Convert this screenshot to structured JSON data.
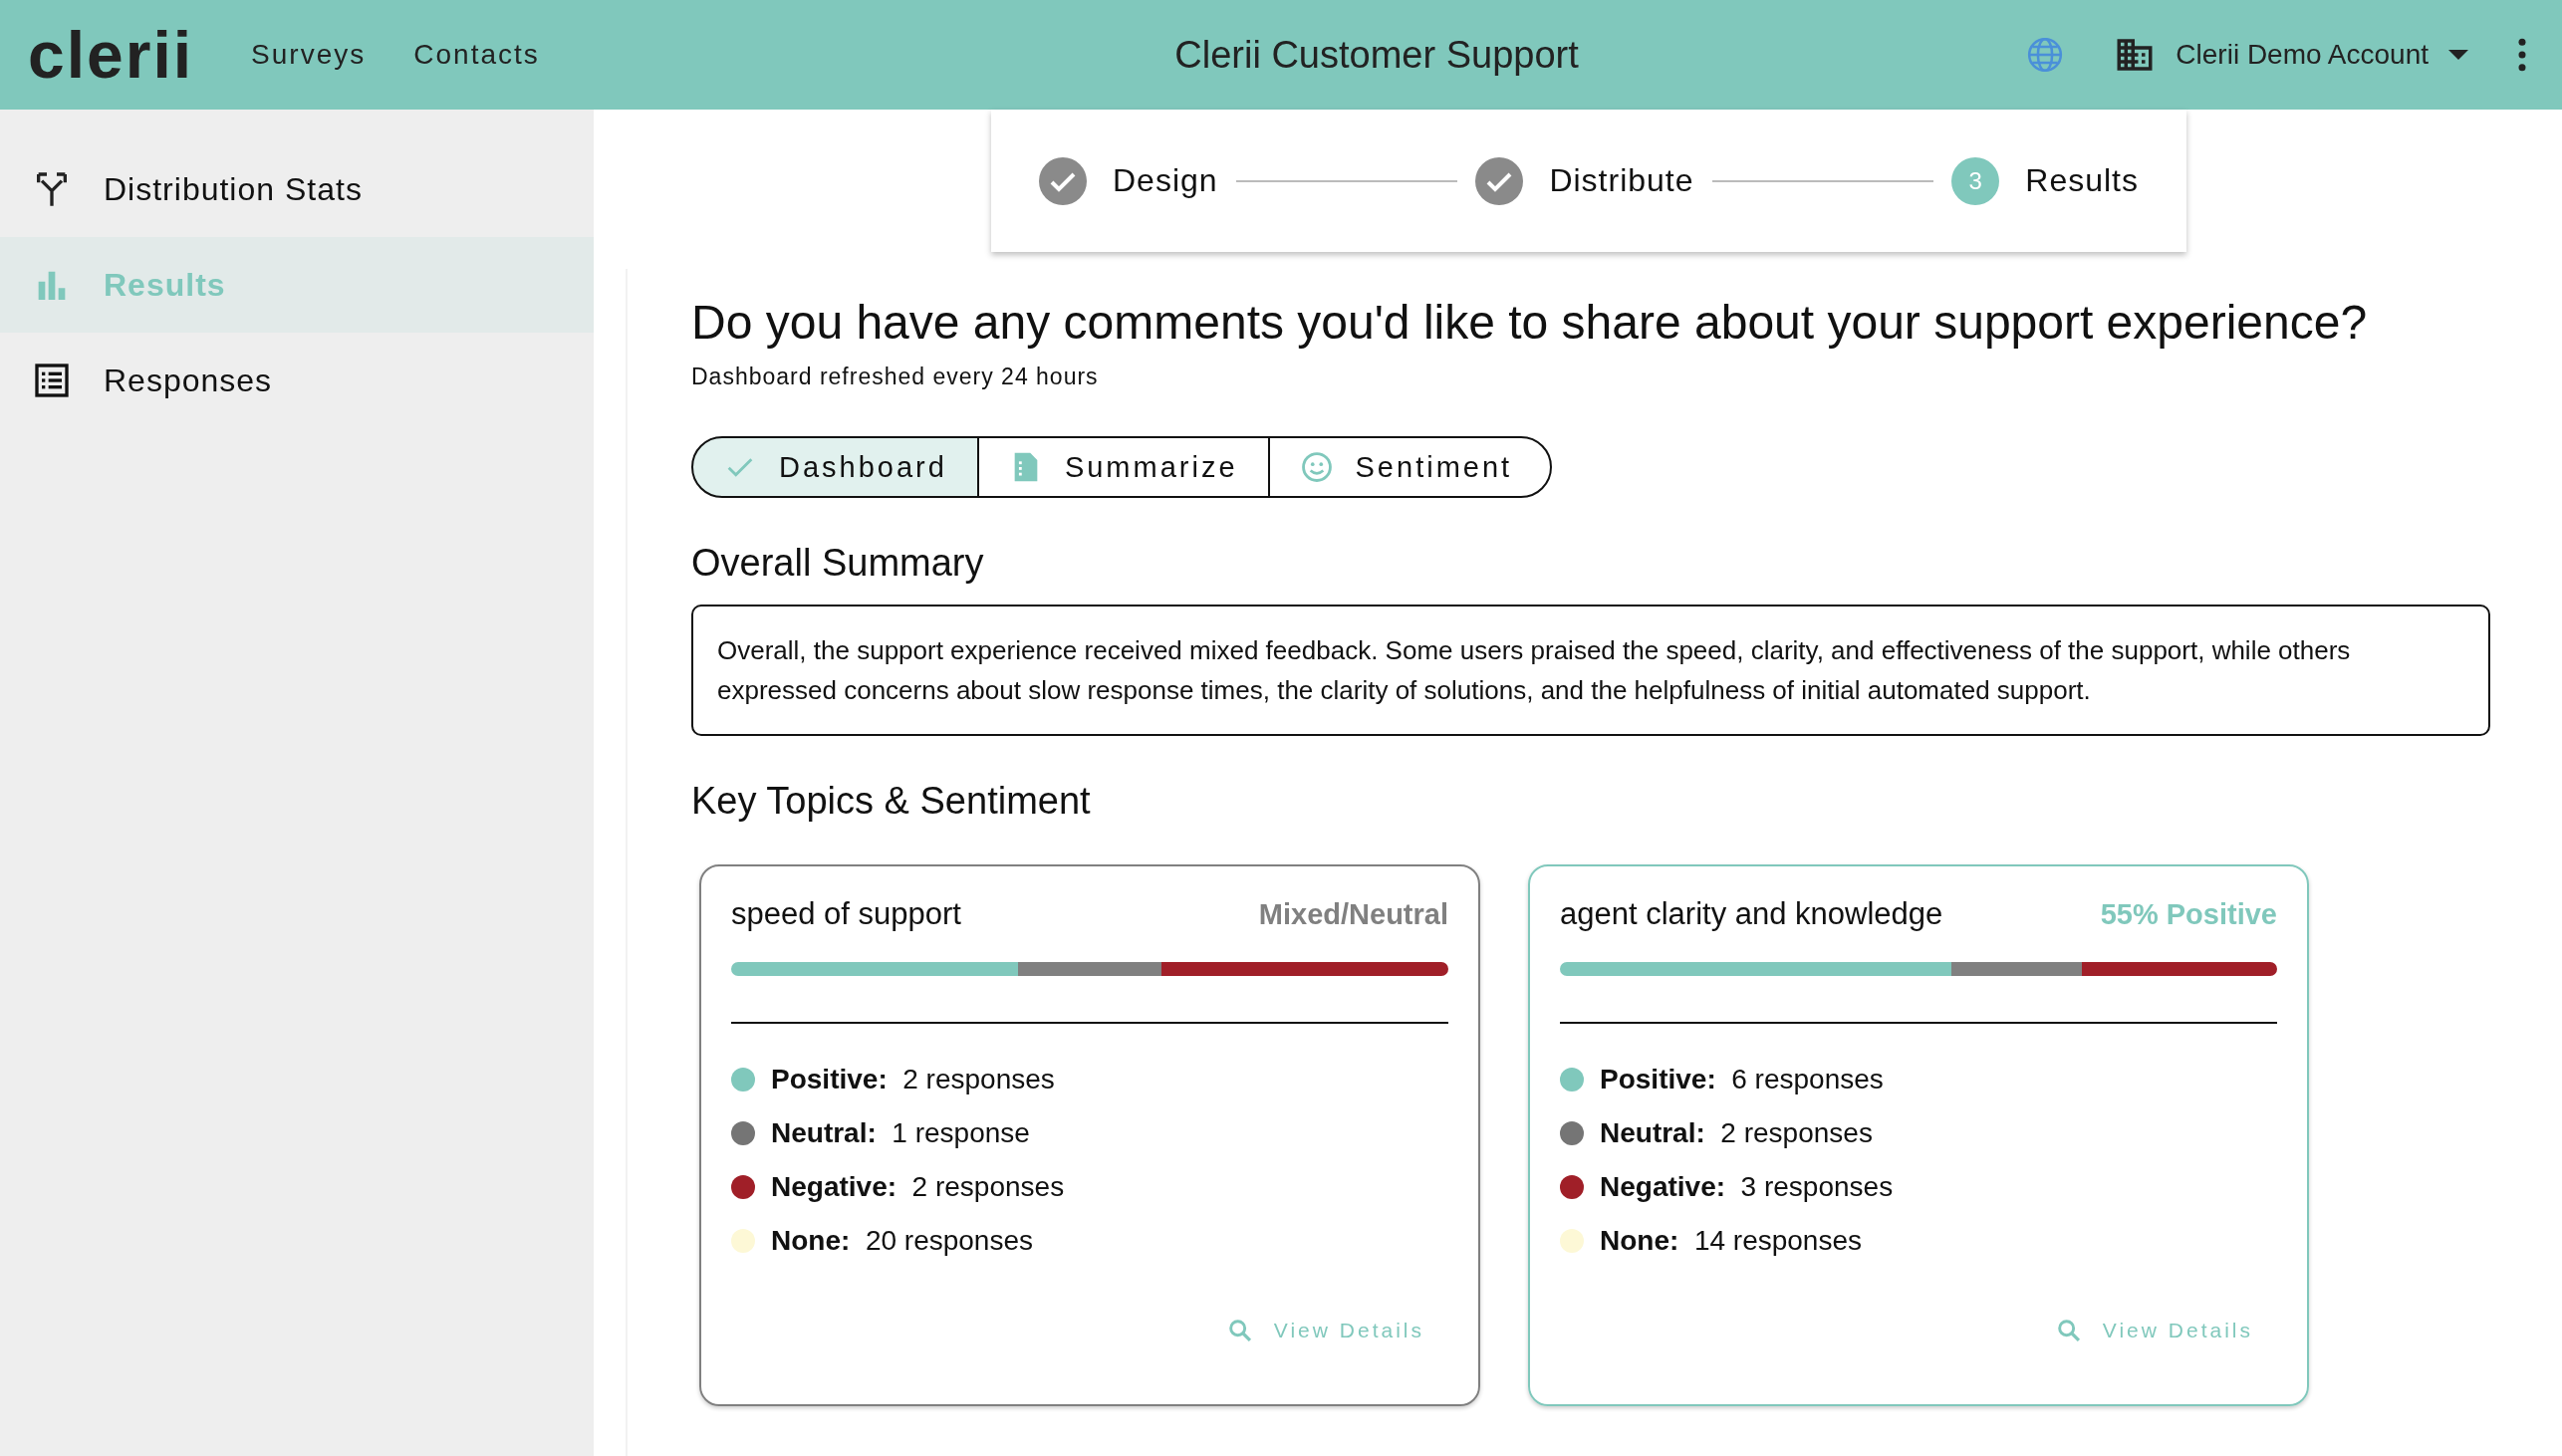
{
  "header": {
    "logo": "clerii",
    "nav": [
      {
        "label": "Surveys"
      },
      {
        "label": "Contacts"
      }
    ],
    "title": "Clerii Customer Support",
    "account": "Clerii Demo Account"
  },
  "sidebar": {
    "items": [
      {
        "label": "Distribution Stats",
        "selected": false
      },
      {
        "label": "Results",
        "selected": true
      },
      {
        "label": "Responses",
        "selected": false
      }
    ]
  },
  "stepper": [
    {
      "label": "Design",
      "completed": true
    },
    {
      "label": "Distribute",
      "completed": true
    },
    {
      "label": "Results",
      "completed": false,
      "number": "3"
    }
  ],
  "question": "Do you have any comments you'd like to share about your support experience?",
  "refresh_note": "Dashboard refreshed every 24 hours",
  "tabs": [
    {
      "label": "Dashboard",
      "selected": true
    },
    {
      "label": "Summarize",
      "selected": false
    },
    {
      "label": "Sentiment",
      "selected": false
    }
  ],
  "summary": {
    "title": "Overall Summary",
    "text": "Overall, the support experience received mixed feedback. Some users praised the speed, clarity, and effectiveness of the support, while others expressed concerns about slow response times, the clarity of solutions, and the helpfulness of initial automated support."
  },
  "topics_title": "Key Topics & Sentiment",
  "topics": [
    {
      "name": "speed of support",
      "status": "Mixed/Neutral",
      "color": "#808080",
      "sentiments": [
        {
          "label": "Positive:",
          "value": "2 responses",
          "color": "#80c8bc"
        },
        {
          "label": "Neutral:",
          "value": "1 response",
          "color": "#757575"
        },
        {
          "label": "Negative:",
          "value": "2 responses",
          "color": "#a01f28"
        },
        {
          "label": "None:",
          "value": "20 responses",
          "color": "#fdf8d6"
        }
      ],
      "link": "View Details"
    },
    {
      "name": "agent clarity and knowledge",
      "status": "55% Positive",
      "color": "#80c8bc",
      "sentiments": [
        {
          "label": "Positive:",
          "value": "6 responses",
          "color": "#80c8bc"
        },
        {
          "label": "Neutral:",
          "value": "2 responses",
          "color": "#757575"
        },
        {
          "label": "Negative:",
          "value": "3 responses",
          "color": "#a01f28"
        },
        {
          "label": "None:",
          "value": "14 responses",
          "color": "#fdf8d6"
        }
      ],
      "link": "View Details"
    }
  ]
}
